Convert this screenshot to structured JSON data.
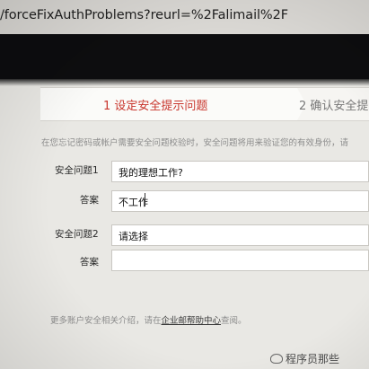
{
  "browser": {
    "url_visible": "/forceFixAuthProblems?reurl=%2Falimail%2F"
  },
  "steps": [
    {
      "label": "1 设定安全提示问题",
      "active": true,
      "color": "#c8342b"
    },
    {
      "label": "2 确认安全提",
      "active": false
    }
  ],
  "hint": "在您忘记密码或帐户需要安全问题校验时，安全问题将用来验证您的有效身份，请",
  "form": {
    "q1": {
      "label": "安全问题1",
      "value": "我的理想工作?"
    },
    "a1": {
      "label": "答案",
      "value": "不工作"
    },
    "q2": {
      "label": "安全问题2",
      "value": "请选择"
    },
    "a2": {
      "label": "答案",
      "value": ""
    }
  },
  "footer": {
    "prefix": "更多账户安全相关介绍，请在",
    "link": "企业邮帮助中心",
    "suffix": "查阅。"
  },
  "watermark": "程序员那些"
}
